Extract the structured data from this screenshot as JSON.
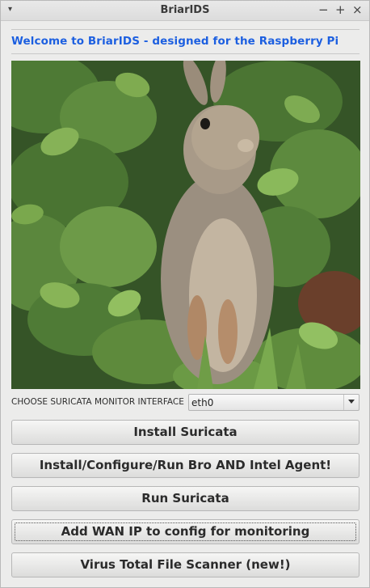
{
  "window": {
    "title": "BriarIDS",
    "menu_glyph": "▾",
    "controls": {
      "minimize": "−",
      "maximize": "+",
      "close": "×"
    }
  },
  "welcome_text": "Welcome to BriarIDS - designed for the Raspberry Pi",
  "accent_color": "#1c5fe0",
  "image": {
    "subject": "rabbit-standing-in-foliage"
  },
  "interface_selector": {
    "label": "CHOOSE SURICATA MONITOR INTERFACE",
    "selected": "eth0"
  },
  "buttons": [
    {
      "label": "Install Suricata"
    },
    {
      "label": "Install/Configure/Run Bro AND Intel Agent!"
    },
    {
      "label": "Run Suricata"
    },
    {
      "label": "Add WAN IP to config for monitoring"
    },
    {
      "label": "Virus Total File Scanner (new!)"
    }
  ]
}
